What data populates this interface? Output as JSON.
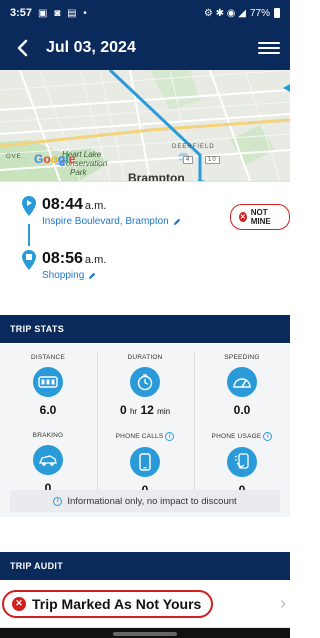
{
  "status_bar": {
    "time": "3:57",
    "battery": "77%"
  },
  "header": {
    "title": "Jul 03, 2024"
  },
  "map": {
    "labels": {
      "deerfield": "DEERFIELD",
      "heart_lake": "Heart Lake",
      "conservation": "Conservation",
      "park": "Park",
      "brampton": "Brampton",
      "ove": "OVE",
      "google": "Google",
      "road_4": "4",
      "road_10": "10"
    }
  },
  "trip": {
    "start": {
      "time": "08:44",
      "ampm": "a.m.",
      "place": "Inspire Boulevard, Brampton"
    },
    "end": {
      "time": "08:56",
      "ampm": "a.m.",
      "place": "Shopping"
    },
    "badge": "NOT MINE"
  },
  "sections": {
    "trip_stats": "TRIP STATS",
    "trip_audit": "TRIP AUDIT"
  },
  "stats": [
    {
      "label": "DISTANCE",
      "value": "6.0",
      "icon": "odometer-icon"
    },
    {
      "label": "DURATION",
      "value_hr": "0",
      "unit_hr": "hr",
      "value_min": "12",
      "unit_min": "min",
      "icon": "stopwatch-icon"
    },
    {
      "label": "SPEEDING",
      "value": "0.0",
      "icon": "speedometer-icon"
    },
    {
      "label": "BRAKING",
      "value": "0",
      "icon": "braking-car-icon"
    },
    {
      "label": "PHONE CALLS",
      "value": "0",
      "icon": "phone-icon"
    },
    {
      "label": "PHONE USAGE",
      "value": "0",
      "icon": "phone-tap-icon"
    }
  ],
  "notice": "Informational only, no impact to discount",
  "audit": {
    "text": "Trip Marked As Not Yours"
  },
  "colors": {
    "navy": "#0a2a5c",
    "accent": "#2a9bd8",
    "alert": "#d11f1f"
  }
}
